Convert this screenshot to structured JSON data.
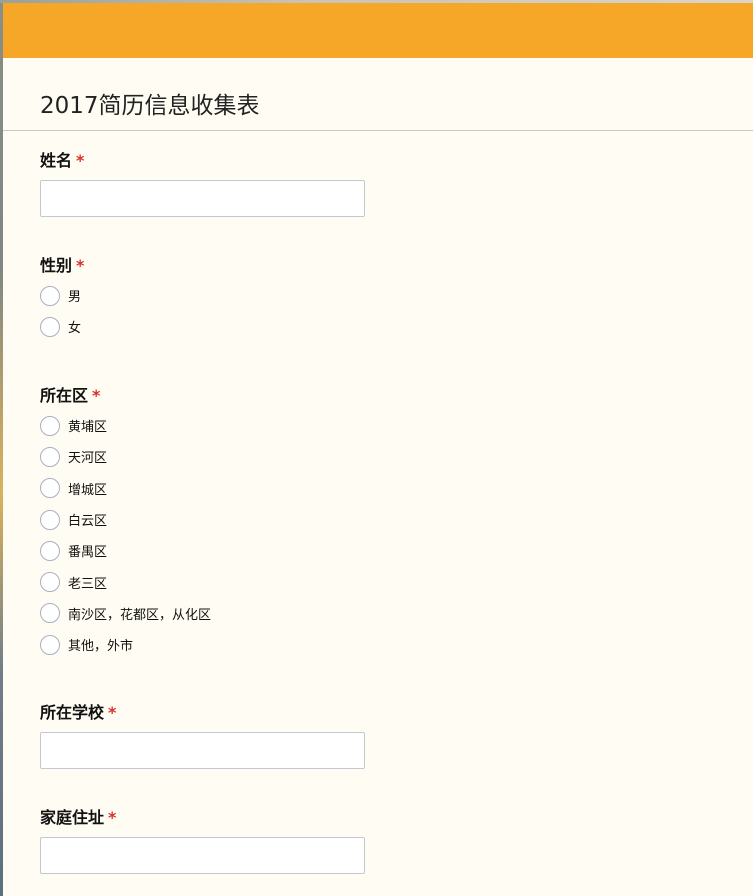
{
  "form": {
    "title": "2017简历信息收集表",
    "accent_color": "#f6a727",
    "background_color": "#fffdf3",
    "required_marker": "*",
    "required_color": "#d9302a"
  },
  "questions": {
    "name": {
      "label": "姓名",
      "type": "text",
      "value": ""
    },
    "gender": {
      "label": "性别",
      "type": "radio",
      "options": [
        "男",
        "女"
      ]
    },
    "district": {
      "label": "所在区",
      "type": "radio",
      "options": [
        "黄埔区",
        "天河区",
        "增城区",
        "白云区",
        "番禺区",
        "老三区",
        "南沙区，花都区，从化区",
        "其他，外市"
      ]
    },
    "school": {
      "label": "所在学校",
      "type": "text",
      "value": ""
    },
    "address": {
      "label": "家庭住址",
      "type": "text",
      "value": ""
    }
  }
}
